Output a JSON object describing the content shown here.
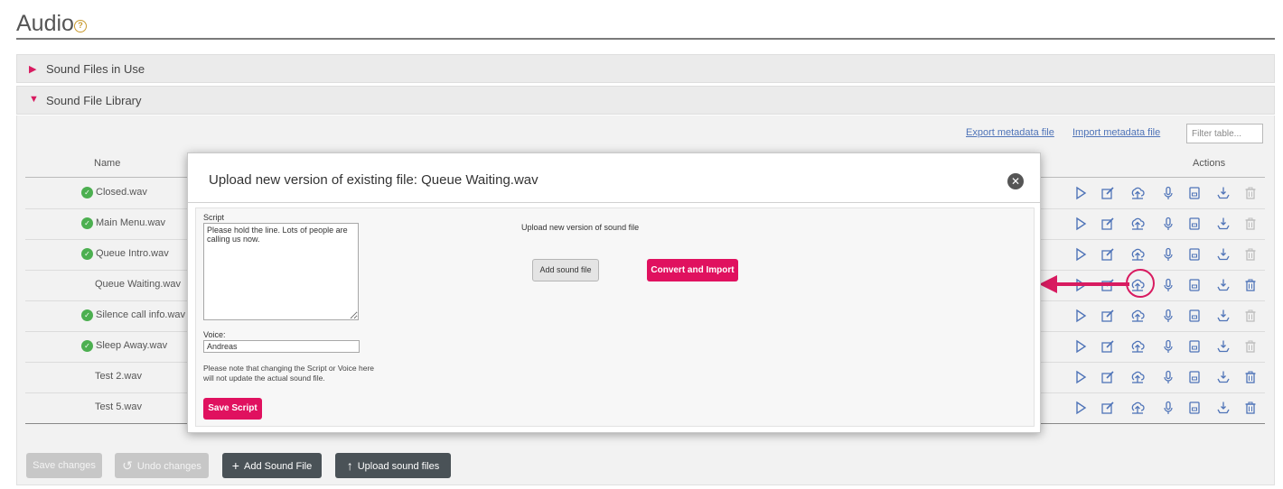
{
  "page": {
    "title": "Audio",
    "help_icon": "?"
  },
  "sections": {
    "in_use": {
      "label": "Sound Files in Use",
      "arrow": "▶"
    },
    "library": {
      "label": "Sound File Library",
      "arrow": "▼"
    }
  },
  "toolbar": {
    "export_label": "Export metadata file",
    "import_label": "Import metadata file",
    "filter_placeholder": "Filter table..."
  },
  "table": {
    "columns": {
      "name": "Name",
      "actions": "Actions"
    },
    "rows": [
      {
        "name": "Closed.wav",
        "checked": true,
        "delete_enabled": false
      },
      {
        "name": "Main Menu.wav",
        "checked": true,
        "delete_enabled": false
      },
      {
        "name": "Queue Intro.wav",
        "checked": true,
        "delete_enabled": false
      },
      {
        "name": "Queue Waiting.wav",
        "checked": false,
        "delete_enabled": true
      },
      {
        "name": "Silence call info.wav",
        "checked": true,
        "delete_enabled": false
      },
      {
        "name": "Sleep Away.wav",
        "checked": true,
        "delete_enabled": false
      },
      {
        "name": "Test 2.wav",
        "checked": false,
        "delete_enabled": true
      },
      {
        "name": "Test 5.wav",
        "checked": false,
        "delete_enabled": true
      }
    ],
    "action_icons": [
      "play-icon",
      "edit-icon",
      "upload-version-icon",
      "microphone-icon",
      "document-icon",
      "download-icon",
      "trash-icon"
    ]
  },
  "buttons": {
    "save_changes": "Save changes",
    "undo_changes": "Undo changes",
    "undo_icon": "↺",
    "add_sound_file": "Add Sound File",
    "add_icon": "+",
    "upload_sound_files": "Upload sound files",
    "upload_icon": "↑"
  },
  "modal": {
    "title": "Upload new version of existing file: Queue Waiting.wav",
    "close_icon": "✕",
    "script_label": "Script",
    "script_value": "Please hold the line. Lots of people are calling us now.",
    "voice_label": "Voice:",
    "voice_value": "Andreas",
    "note": "Please note that changing the Script or Voice here will not update the actual sound file.",
    "save_script": "Save Script",
    "upload_label": "Upload new version of sound file",
    "add_sound_file": "Add sound file",
    "convert_import": "Convert and Import"
  },
  "colors": {
    "accent": "#e0115f",
    "icon": "#4f74b8",
    "icon_disabled": "#bdbdbd",
    "check": "#4caf50"
  }
}
